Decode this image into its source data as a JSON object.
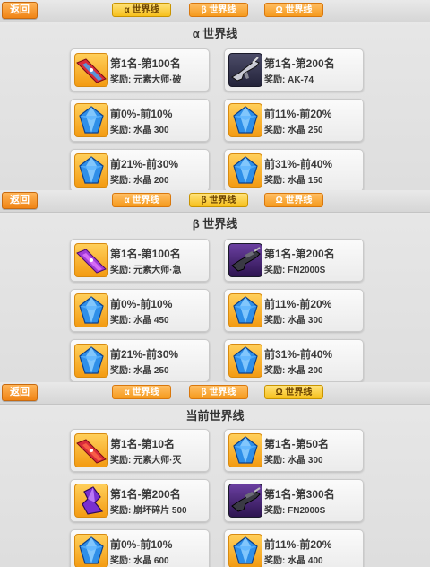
{
  "panels": [
    {
      "back_label": "返回",
      "tabs": [
        {
          "label": "α 世界线",
          "active": true
        },
        {
          "label": "β 世界线",
          "active": false
        },
        {
          "label": "Ω 世界线",
          "active": false
        }
      ],
      "title": "α 世界线",
      "cards": [
        {
          "icon": "red-ribbon-icon",
          "rank": "第1名-第100名",
          "reward": "奖励: 元素大师·破"
        },
        {
          "icon": "ak74-rifle-icon",
          "rank": "第1名-第200名",
          "reward": "奖励: AK-74"
        },
        {
          "icon": "blue-crystal-icon",
          "rank": "前0%-前10%",
          "reward": "奖励: 水晶 300"
        },
        {
          "icon": "blue-crystal-icon",
          "rank": "前11%-前20%",
          "reward": "奖励: 水晶 250"
        },
        {
          "icon": "blue-crystal-icon",
          "rank": "前21%-前30%",
          "reward": "奖励: 水晶 200"
        },
        {
          "icon": "blue-crystal-icon",
          "rank": "前31%-前40%",
          "reward": "奖励: 水晶 150"
        }
      ]
    },
    {
      "back_label": "返回",
      "tabs": [
        {
          "label": "α 世界线",
          "active": false
        },
        {
          "label": "β 世界线",
          "active": true
        },
        {
          "label": "Ω 世界线",
          "active": false
        }
      ],
      "title": "β 世界线",
      "cards": [
        {
          "icon": "purple-ribbon-icon",
          "rank": "第1名-第100名",
          "reward": "奖励: 元素大师·急"
        },
        {
          "icon": "fn2000s-rifle-icon",
          "rank": "第1名-第200名",
          "reward": "奖励: FN2000S"
        },
        {
          "icon": "blue-crystal-icon",
          "rank": "前0%-前10%",
          "reward": "奖励: 水晶 450"
        },
        {
          "icon": "blue-crystal-icon",
          "rank": "前11%-前20%",
          "reward": "奖励: 水晶 300"
        },
        {
          "icon": "blue-crystal-icon",
          "rank": "前21%-前30%",
          "reward": "奖励: 水晶 250"
        },
        {
          "icon": "blue-crystal-icon",
          "rank": "前31%-前40%",
          "reward": "奖励: 水晶 200"
        }
      ]
    },
    {
      "back_label": "返回",
      "tabs": [
        {
          "label": "α 世界线",
          "active": false
        },
        {
          "label": "β 世界线",
          "active": false
        },
        {
          "label": "Ω 世界线",
          "active": true
        }
      ],
      "title": "当前世界线",
      "cards": [
        {
          "icon": "red-ribbon-icon",
          "rank": "第1名-第10名",
          "reward": "奖励: 元素大师·灭"
        },
        {
          "icon": "blue-crystal-icon",
          "rank": "第1名-第50名",
          "reward": "奖励: 水晶 300"
        },
        {
          "icon": "purple-shard-icon",
          "rank": "第1名-第200名",
          "reward": "奖励: 崩坏碎片 500"
        },
        {
          "icon": "fn2000s-rifle-icon",
          "rank": "第1名-第300名",
          "reward": "奖励: FN2000S"
        },
        {
          "icon": "blue-crystal-icon",
          "rank": "前0%-前10%",
          "reward": "奖励: 水晶 600"
        },
        {
          "icon": "blue-crystal-icon",
          "rank": "前11%-前20%",
          "reward": "奖励: 水晶 400"
        }
      ]
    }
  ],
  "colors": {
    "tab_active": "#f6c01c",
    "tab_inactive": "#f59a1e",
    "back_button": "#f08415",
    "icon_frame": "#f39b12",
    "crystal": "#2f8fe8"
  }
}
